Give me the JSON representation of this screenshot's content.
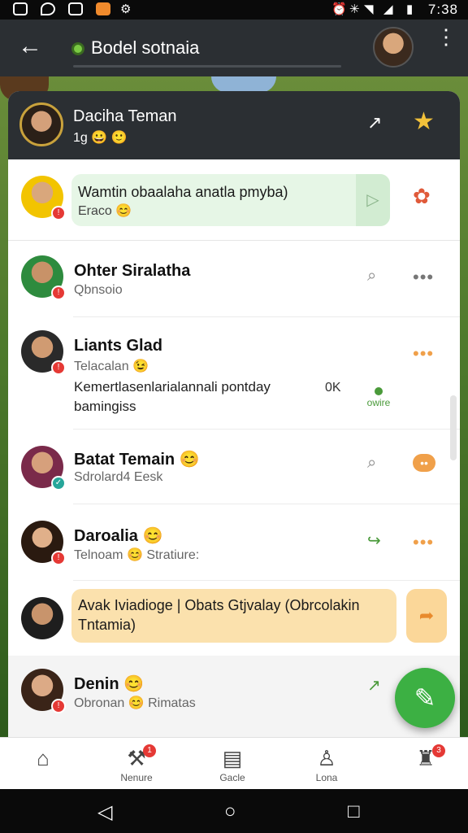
{
  "status_bar": {
    "time": "7:38",
    "icons": [
      "whatsapp-icon",
      "location-icon",
      "image-icon",
      "app-icon",
      "settings-icon",
      "alarm-icon",
      "vibrate-icon",
      "wifi-icon",
      "signal-icon",
      "battery-icon"
    ]
  },
  "app_bar": {
    "title": "Bodel sotnaia",
    "online_color": "#7ac943"
  },
  "header_card": {
    "name": "Daciha Teman",
    "subtitle": "1g"
  },
  "rows": [
    {
      "type": "bubble",
      "bubble_text": "Wamtin obaalaha anatla pmyba)",
      "bubble_sub": "Eraco"
    },
    {
      "name": "Ohter Siralatha",
      "sub": "Qbnsoio"
    },
    {
      "name": "Liants Glad",
      "sub": "Telacalan",
      "text": "Kemertlasenlarialannali pontday bamingiss",
      "ok": "0K",
      "wire": "owire"
    },
    {
      "name": "Batat Temain",
      "sub": "Sdrolard4 Eesk"
    },
    {
      "name": "Daroalia",
      "sub": "Telnoam",
      "sub2": "Stratiure:"
    },
    {
      "type": "bubble_orange",
      "bubble_text": "Avak Iviadioge | Obats Gtjvalay (Obrcolakin Tntamia)"
    },
    {
      "name": "Denin",
      "sub": "Obronan",
      "sub2": "Rimatas"
    }
  ],
  "bottom_nav": [
    {
      "label": "",
      "icon": "home-icon"
    },
    {
      "label": "Nenure",
      "icon": "tools-icon",
      "badge": "1"
    },
    {
      "label": "Gacle",
      "icon": "message-icon",
      "badge": ""
    },
    {
      "label": "Lona",
      "icon": "person-icon"
    },
    {
      "label": "",
      "icon": "notifications-icon",
      "badge": "3"
    }
  ],
  "colors": {
    "app_bar": "#2b2f33",
    "fab": "#3cb043",
    "green_bubble": "#e6f6e6",
    "orange_bubble": "#fbe1ad"
  }
}
